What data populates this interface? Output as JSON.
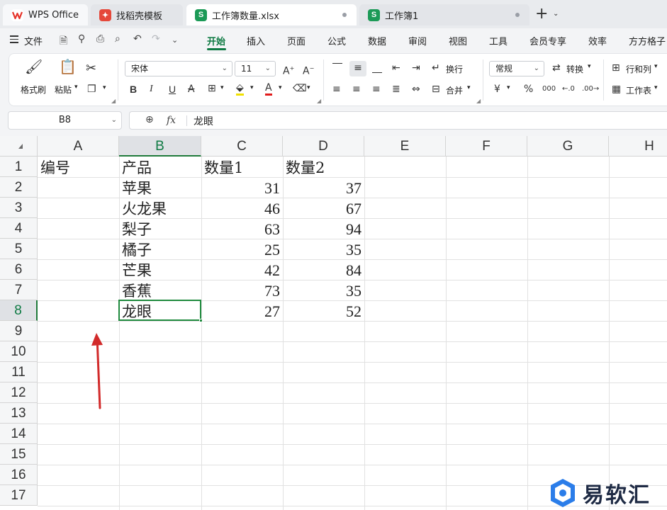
{
  "tabs": [
    {
      "label": "WPS Office",
      "icon": "wps-logo-icon"
    },
    {
      "label": "找稻壳模板",
      "icon": "daoke-icon"
    },
    {
      "label": "工作簿数量.xlsx",
      "icon": "sheet-s-icon",
      "icon_letter": "S",
      "active": true
    },
    {
      "label": "工作簿1",
      "icon": "sheet-s-icon",
      "icon_letter": "S"
    }
  ],
  "menu": {
    "file": "文件",
    "items": [
      "开始",
      "插入",
      "页面",
      "公式",
      "数据",
      "审阅",
      "视图",
      "工具",
      "会员专享",
      "效率",
      "方方格子"
    ],
    "active": "开始"
  },
  "ribbon": {
    "format_painter": "格式刷",
    "paste": "粘贴",
    "font_name": "宋体",
    "font_size": "11",
    "bold": "B",
    "italic": "I",
    "underline": "U",
    "wrap": "换行",
    "merge": "合并",
    "number_format": "常规",
    "convert": "转换",
    "row_col": "行和列",
    "worksheet": "工作表",
    "currency_symbol": "¥",
    "percent_symbol": "%"
  },
  "formula_bar": {
    "name_box": "B8",
    "fx": "fx",
    "value": "龙眼"
  },
  "columns": [
    "A",
    "B",
    "C",
    "D",
    "E",
    "F",
    "G",
    "H"
  ],
  "selected_column": "B",
  "rows": [
    "1",
    "2",
    "3",
    "4",
    "5",
    "6",
    "7",
    "8",
    "9",
    "10",
    "11",
    "12",
    "13",
    "14",
    "15",
    "16",
    "17"
  ],
  "selected_row": "8",
  "cells": {
    "header": [
      "编号",
      "产品",
      "数量1",
      "数量2"
    ],
    "data": [
      {
        "product": "苹果",
        "qty1": "31",
        "qty2": "37"
      },
      {
        "product": "火龙果",
        "qty1": "46",
        "qty2": "67"
      },
      {
        "product": "梨子",
        "qty1": "63",
        "qty2": "94"
      },
      {
        "product": "橘子",
        "qty1": "25",
        "qty2": "35"
      },
      {
        "product": "芒果",
        "qty1": "42",
        "qty2": "84"
      },
      {
        "product": "香蕉",
        "qty1": "73",
        "qty2": "35"
      },
      {
        "product": "龙眼",
        "qty1": "27",
        "qty2": "52"
      }
    ]
  },
  "active_cell": "B8",
  "colors": {
    "accent_green": "#0e7a43",
    "selection_border": "#1f8a3e",
    "annotation_arrow": "#d22a2a"
  },
  "watermark": {
    "text": "易软汇"
  }
}
